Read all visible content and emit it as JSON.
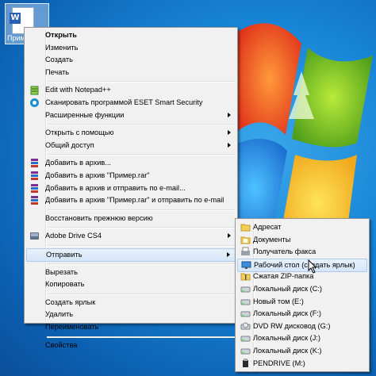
{
  "desktop": {
    "file_icon": {
      "name": "Прим",
      "icon": "word-doc-icon"
    }
  },
  "context_menu": {
    "items": [
      {
        "label": "Открыть",
        "bold": true
      },
      {
        "label": "Изменить"
      },
      {
        "label": "Создать"
      },
      {
        "label": "Печать"
      },
      {
        "label": "Edit with Notepad++",
        "icon": "notepad-plus-icon"
      },
      {
        "label": "Сканировать программой ESET Smart Security",
        "icon": "eset-icon"
      },
      {
        "label": "Расширенные функции",
        "submenu": true
      },
      {
        "label": "Открыть с помощью",
        "submenu": true
      },
      {
        "label": "Общий доступ",
        "submenu": true
      },
      {
        "label": "Добавить в архив...",
        "icon": "winrar-icon"
      },
      {
        "label": "Добавить в архив \"Пример.rar\"",
        "icon": "winrar-icon"
      },
      {
        "label": "Добавить в архив и отправить по e-mail...",
        "icon": "winrar-icon"
      },
      {
        "label": "Добавить в архив \"Пример.rar\" и отправить по e-mail",
        "icon": "winrar-icon"
      },
      {
        "label": "Восстановить прежнюю версию"
      },
      {
        "label": "Adobe Drive CS4",
        "icon": "adobe-drive-icon",
        "submenu": true
      },
      {
        "label": "Отправить",
        "submenu": true,
        "highlighted": true
      },
      {
        "label": "Вырезать"
      },
      {
        "label": "Копировать"
      },
      {
        "label": "Создать ярлык"
      },
      {
        "label": "Удалить"
      },
      {
        "label": "Переименовать"
      },
      {
        "label": "Свойства"
      }
    ]
  },
  "send_to_menu": {
    "items": [
      {
        "label": "Адресат",
        "icon": "folder-icon"
      },
      {
        "label": "Документы",
        "icon": "documents-icon"
      },
      {
        "label": "Получатель факса",
        "icon": "fax-icon"
      },
      {
        "label": "Рабочий стол (создать ярлык)",
        "icon": "desktop-icon",
        "highlighted": true
      },
      {
        "label": "Сжатая ZIP-папка",
        "icon": "zip-folder-icon"
      },
      {
        "label": "Локальный диск (C:)",
        "icon": "drive-icon"
      },
      {
        "label": "Новый том (E:)",
        "icon": "drive-icon"
      },
      {
        "label": "Локальный диск (F:)",
        "icon": "drive-icon"
      },
      {
        "label": "DVD RW дисковод (G:)",
        "icon": "dvd-drive-icon"
      },
      {
        "label": "Локальный диск (J:)",
        "icon": "drive-icon"
      },
      {
        "label": "Локальный диск (K:)",
        "icon": "drive-icon"
      },
      {
        "label": "PENDRIVE (M:)",
        "icon": "usb-drive-icon"
      }
    ]
  },
  "colors": {
    "highlight_border": "#aecaf0",
    "menu_bg": "#f1f1f1",
    "desktop": "#1784d6"
  }
}
